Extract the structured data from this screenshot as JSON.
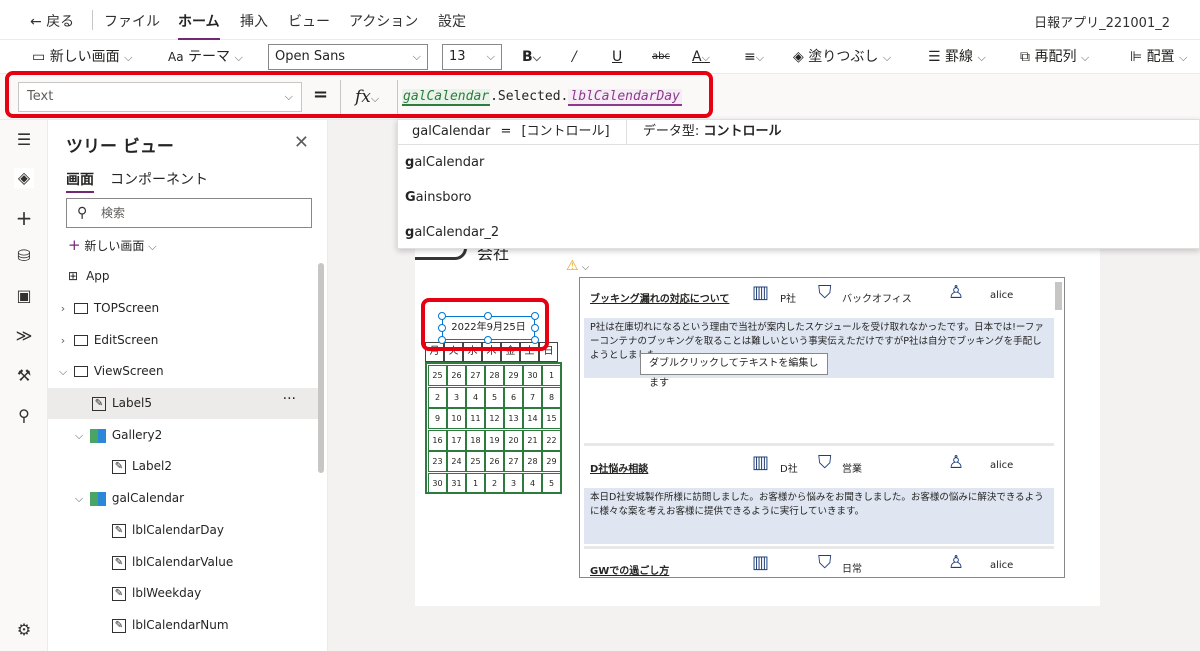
{
  "menubar": {
    "back": "戻る",
    "items": [
      "ファイル",
      "ホーム",
      "挿入",
      "ビュー",
      "アクション",
      "設定"
    ],
    "active": "ホーム",
    "app_title": "日報アプリ_221001_2"
  },
  "ribbon": {
    "new_screen": "新しい画面",
    "theme": "テーマ",
    "font": "Open Sans",
    "font_size": "13",
    "fill": "塗りつぶし",
    "border": "罫線",
    "reorder": "再配列",
    "align": "配置"
  },
  "formula_bar": {
    "property": "Text",
    "equals": "=",
    "fx": "fx",
    "token1": "galCalendar",
    "mid": ".Selected.",
    "token2": "lblCalendarDay"
  },
  "intellisense": {
    "header_name": "galCalendar",
    "header_eq": "=",
    "header_kind": "[コントロール]",
    "header_type_label": "データ型:",
    "header_type_value": "コントロール",
    "suggestions": [
      {
        "bold": "g",
        "rest": "alCalendar"
      },
      {
        "bold": "G",
        "rest": "ainsboro"
      },
      {
        "bold": "g",
        "rest": "alCalendar_2"
      }
    ]
  },
  "tree": {
    "title": "ツリー ビュー",
    "tabs": [
      "画面",
      "コンポーネント"
    ],
    "search_placeholder": "検索",
    "new_screen": "新しい画面",
    "nodes": [
      "App",
      "TOPScreen",
      "EditScreen",
      "ViewScreen",
      "Label5",
      "Gallery2",
      "Label2",
      "galCalendar",
      "lblCalendarDay",
      "lblCalendarValue",
      "lblWeekday",
      "lblCalendarNum"
    ]
  },
  "canvas": {
    "header_fragment": "会社",
    "date_label": "2022年9月25日",
    "weekdays": [
      "月",
      "火",
      "水",
      "木",
      "金",
      "土",
      "日"
    ],
    "calendar": [
      [
        "25",
        "26",
        "27",
        "28",
        "29",
        "30",
        "1"
      ],
      [
        "2",
        "3",
        "4",
        "5",
        "6",
        "7",
        "8"
      ],
      [
        "9",
        "10",
        "11",
        "12",
        "13",
        "14",
        "15"
      ],
      [
        "16",
        "17",
        "18",
        "19",
        "20",
        "21",
        "22"
      ],
      [
        "23",
        "24",
        "25",
        "26",
        "27",
        "28",
        "29"
      ],
      [
        "30",
        "31",
        "1",
        "2",
        "3",
        "4",
        "5"
      ]
    ],
    "tooltip": "ダブルクリックしてテキストを編集します",
    "cards": [
      {
        "title": "ブッキング漏れの対応について",
        "company": "P社",
        "dept": "バックオフィス",
        "user": "alice",
        "body": "P社は在庫切れになるという理由で当社が案内したスケジュールを受け取れなかったです。日本では!ーファーコンテナのブッキングを取ることは難しいという事実伝えただけですがP社は自分でブッキングを手配しようとしました"
      },
      {
        "title": "D社悩み相談",
        "company": "D社",
        "dept": "営業",
        "user": "alice",
        "body": "本日D社安城製作所様に訪問しました。お客様から悩みをお聞きしました。お客様の悩みに解決できるように様々な案を考えお客様に提供できるように実行していきます。"
      },
      {
        "title": "GWでの過ごし方",
        "company": "",
        "dept": "日常",
        "user": "alice",
        "body": ""
      }
    ]
  },
  "colors": {
    "accent": "#742774",
    "highlight": "#e60012",
    "calendar_border": "#2d7b3e",
    "icon": "#1f3f7a"
  }
}
